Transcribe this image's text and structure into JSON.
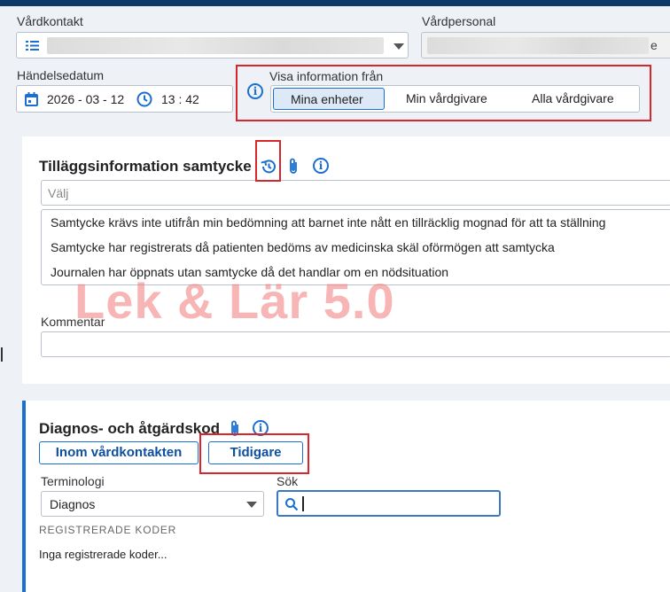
{
  "header": {
    "vardkontakt_label": "Vårdkontakt",
    "vardpersonal_label": "Vårdpersonal",
    "vardpersonal_tail": "e",
    "handelsedatum_label": "Händelsedatum",
    "date_value": "2026 - 03 - 12",
    "time_value": "13 : 42",
    "visa_label": "Visa information från",
    "visa_options": [
      "Mina enheter",
      "Min vårdgivare",
      "Alla vårdgivare"
    ],
    "visa_selected": "Mina enheter"
  },
  "samtycke": {
    "title": "Tilläggsinformation samtycke",
    "select_placeholder": "Välj",
    "options": [
      "Samtycke krävs inte utifrån min bedömning att barnet inte nått en tillräcklig mognad för att ta ställning",
      "Samtycke har registrerats då patienten bedöms av medicinska skäl oförmögen att samtycka",
      "Journalen har öppnats utan samtycke då det handlar om en nödsituation"
    ],
    "kommentar_label": "Kommentar",
    "kommentar_value": ""
  },
  "watermark": "Lek & Lär 5.0",
  "diagnos": {
    "title": "Diagnos- och åtgärdskod",
    "tab_inom": "Inom vårdkontakten",
    "tab_tidigare": "Tidigare",
    "terminologi_label": "Terminologi",
    "terminologi_value": "Diagnos",
    "sok_label": "Sök",
    "sok_value": "",
    "registrerade_heading": "REGISTRERADE KODER",
    "empty_text": "Inga registrerade koder..."
  },
  "colors": {
    "accent": "#1a6fd1",
    "highlight": "#d8262d",
    "topbar": "#0d3868"
  }
}
